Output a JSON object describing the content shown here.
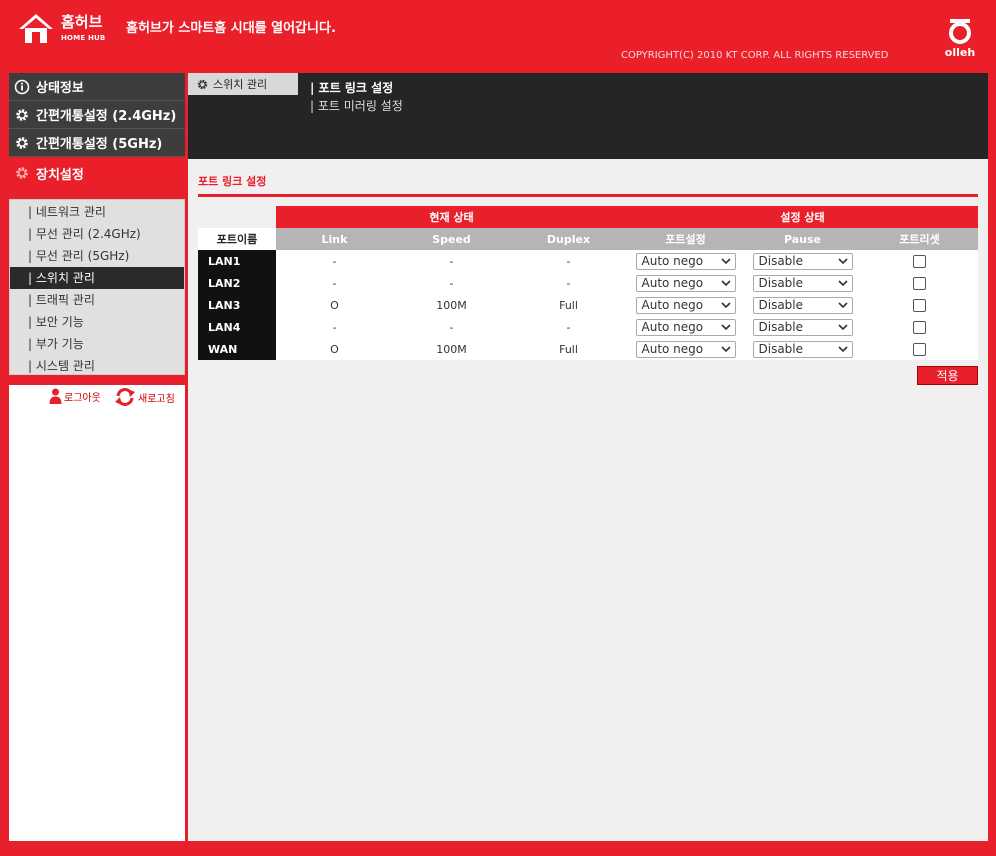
{
  "header": {
    "brand_kr": "홈허브",
    "brand_en": "HOME HUB",
    "slogan": "홈허브가 스마트홈 시대를 열어갑니다.",
    "copyright": "COPYRIGHT(C) 2010 KT CORP. ALL RIGHTS RESERVED",
    "olleh": "olleh"
  },
  "sidebar": {
    "menus": [
      {
        "label": "상태정보",
        "icon": "info-icon"
      },
      {
        "label": "간편개통설정 (2.4GHz)",
        "icon": "gear-icon"
      },
      {
        "label": "간편개통설정 (5GHz)",
        "icon": "gear-icon"
      },
      {
        "label": "장치설정",
        "icon": "gear-icon",
        "active": true
      }
    ],
    "submenu": [
      "| 네트워크 관리",
      "| 무선 관리 (2.4GHz)",
      "| 무선 관리 (5GHz)",
      "| 스위치 관리",
      "| 트래픽 관리",
      "| 보안 기능",
      "| 부가 기능",
      "| 시스템 관리"
    ],
    "submenu_active_index": 3,
    "logout": "로그아웃",
    "refresh": "새로고침"
  },
  "topbar": {
    "tab": "스위치 관리",
    "sublinks": [
      "| 포트 링크 설정",
      "| 포트 미러링 설정"
    ]
  },
  "content": {
    "section_title": "포트 링크 설정",
    "group_current": "현재 상태",
    "group_setting": "설정 상태",
    "col_port": "포트이름",
    "col_link": "Link",
    "col_speed": "Speed",
    "col_duplex": "Duplex",
    "col_portset": "포트설정",
    "col_pause": "Pause",
    "col_reset": "포트리셋",
    "rows": [
      {
        "port": "LAN1",
        "link": "-",
        "speed": "-",
        "duplex": "-",
        "portset": "Auto nego",
        "pause": "Disable",
        "reset": false
      },
      {
        "port": "LAN2",
        "link": "-",
        "speed": "-",
        "duplex": "-",
        "portset": "Auto nego",
        "pause": "Disable",
        "reset": false
      },
      {
        "port": "LAN3",
        "link": "O",
        "speed": "100M",
        "duplex": "Full",
        "portset": "Auto nego",
        "pause": "Disable",
        "reset": false
      },
      {
        "port": "LAN4",
        "link": "-",
        "speed": "-",
        "duplex": "-",
        "portset": "Auto nego",
        "pause": "Disable",
        "reset": false
      },
      {
        "port": "WAN",
        "link": "O",
        "speed": "100M",
        "duplex": "Full",
        "portset": "Auto nego",
        "pause": "Disable",
        "reset": false
      }
    ],
    "apply": "적용"
  },
  "colors": {
    "brand_red": "#e8202c",
    "dark": "#252525"
  }
}
